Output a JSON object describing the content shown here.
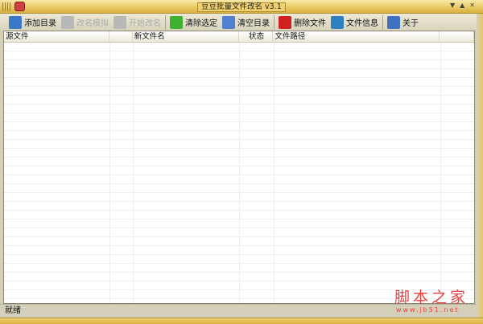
{
  "window": {
    "title": "豆豆批量文件改名 v3.1",
    "controls": [
      "▼",
      "▲",
      "✕"
    ]
  },
  "toolbar": [
    {
      "label": "添加目录",
      "icon": "monitor-icon",
      "color": "#3a78c8",
      "enabled": true
    },
    {
      "label": "改名模拟",
      "icon": "pen-icon",
      "color": "#b8b8b8",
      "enabled": false
    },
    {
      "label": "开始改名",
      "icon": "floppy-icon",
      "color": "#b8b8b8",
      "enabled": false
    },
    {
      "label": "清除选定",
      "icon": "puzzle-icon",
      "color": "#40b030",
      "enabled": true
    },
    {
      "label": "清空目录",
      "icon": "eraser-icon",
      "color": "#5080d0",
      "enabled": true
    },
    {
      "label": "删除文件",
      "icon": "x-icon",
      "color": "#d02020",
      "enabled": true
    },
    {
      "label": "文件信息",
      "icon": "magnifier-icon",
      "color": "#3080c0",
      "enabled": true
    },
    {
      "label": "关于",
      "icon": "user-icon",
      "color": "#4070c0",
      "enabled": true
    }
  ],
  "columns": [
    "源文件",
    "",
    "新文件名",
    "状态",
    "文件路径",
    ""
  ],
  "status": "就绪",
  "watermark": {
    "text": "脚本之家",
    "url": "www.jb51.net"
  }
}
